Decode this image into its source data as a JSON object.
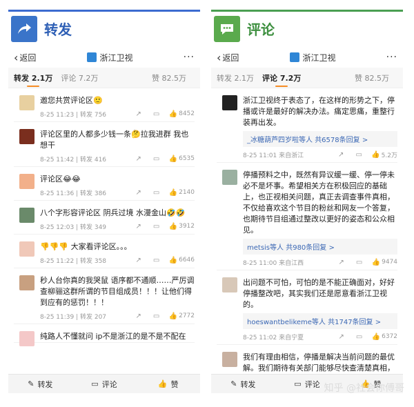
{
  "left": {
    "title": "转发",
    "icon": "share-arrow-icon",
    "accent": "#3a74c9",
    "nav": {
      "back": "返回",
      "account": "浙江卫视",
      "more": "···"
    },
    "tabs": {
      "repost": "转发",
      "repost_count": "2.1万",
      "comment": "评论",
      "comment_count": "7.2万",
      "like": "赞",
      "like_count": "82.5万"
    },
    "comments": [
      {
        "text": "邀您共赏评论区🙂",
        "time": "8-25 11:23 | 转发 756",
        "likes": "8452",
        "avatar_color": "#e8d0a0"
      },
      {
        "text": "评论区里的人都多少钱一条🤔拉我进群 我也想干",
        "time": "8-25 11:42 | 转发 416",
        "likes": "6535",
        "avatar_color": "#7a2e1e"
      },
      {
        "text": "评论区😂😂",
        "time": "8-25 11:36 | 转发 386",
        "likes": "2140",
        "avatar_color": "#f2b08a"
      },
      {
        "text": "八个字形容评论区 阴兵过境 水漫金山🤣🤣",
        "time": "8-25 12:03 | 转发 349",
        "likes": "3912",
        "avatar_color": "#6a8a6a"
      },
      {
        "text": "👎👎👎 大家看评论区。。。",
        "time": "8-25 11:22 | 转发 358",
        "likes": "6646",
        "avatar_color": "#f0c8b8"
      },
      {
        "text": "秒人台你真的我哭鼠 语序都不通顺……严厉调查柳骊这群所谓的节目组成员！！！让他们得到应有的惩罚！！！",
        "time": "8-25 11:39 | 转发 207",
        "likes": "2772",
        "avatar_color": "#c8a080"
      },
      {
        "text": "纯路人不懂就问 ip不是浙江的是不是不配在",
        "time": "",
        "likes": "",
        "avatar_color": "#f4c8c8"
      }
    ],
    "bottom": {
      "repost": "转发",
      "comment": "评论",
      "like": "赞"
    }
  },
  "right": {
    "title": "评论",
    "icon": "comment-bubble-icon",
    "accent": "#5aaa4d",
    "nav": {
      "back": "返回",
      "account": "浙江卫视",
      "more": "···"
    },
    "tabs": {
      "repost": "转发",
      "repost_count": "2.1万",
      "comment": "评论",
      "comment_count": "7.2万",
      "like": "赞",
      "like_count": "82.5万"
    },
    "comments": [
      {
        "text": "浙江卫视终于表态了，在这样的形势之下，停播或许是最好的解决办法。痛定思痛，重整行装再出发。",
        "reply_user": "_冰糖葫芦四岁啦等人",
        "reply_count": "共6578条回复 >",
        "time": "8-25 11:01 来自浙江",
        "likes": "5.2万",
        "avatar_color": "#222222"
      },
      {
        "text": "停播预料之中，既然有异议缓一缓、停一停未必不是坏事。希望相关方在积极回应的基础上，也正视相关问题，真正去调查事件真相，不仅给喜欢这个节目的粉丝和网友一个答复，也期待节目组通过整改以更好的姿态和公众相见。",
        "reply_user": "metsis等人",
        "reply_count": "共980条回复 >",
        "time": "8-25 11:00 来自江西",
        "likes": "9474",
        "avatar_color": "#9ab0a0"
      },
      {
        "text": "出问题不可怕，可怕的是不能正确面对，好好停播整改吧，其实我们还是愿意看浙江卫视的。",
        "reply_user": "hoeswantbelikeme等人",
        "reply_count": "共1747条回复 >",
        "time": "8-25 11:02 来自宁夏",
        "likes": "6372",
        "avatar_color": "#d8c8b8"
      },
      {
        "text": "我们有理由相信，停播是解决当前问题的最优解。我们期待有关部门能够尽快查清楚真相，",
        "reply_user": "",
        "reply_count": "",
        "time": "",
        "likes": "",
        "avatar_color": "#c8b0a0"
      }
    ],
    "bottom": {
      "repost": "转发",
      "comment": "评论",
      "like": "赞"
    }
  },
  "watermark": "知乎 @社会你傅哥"
}
